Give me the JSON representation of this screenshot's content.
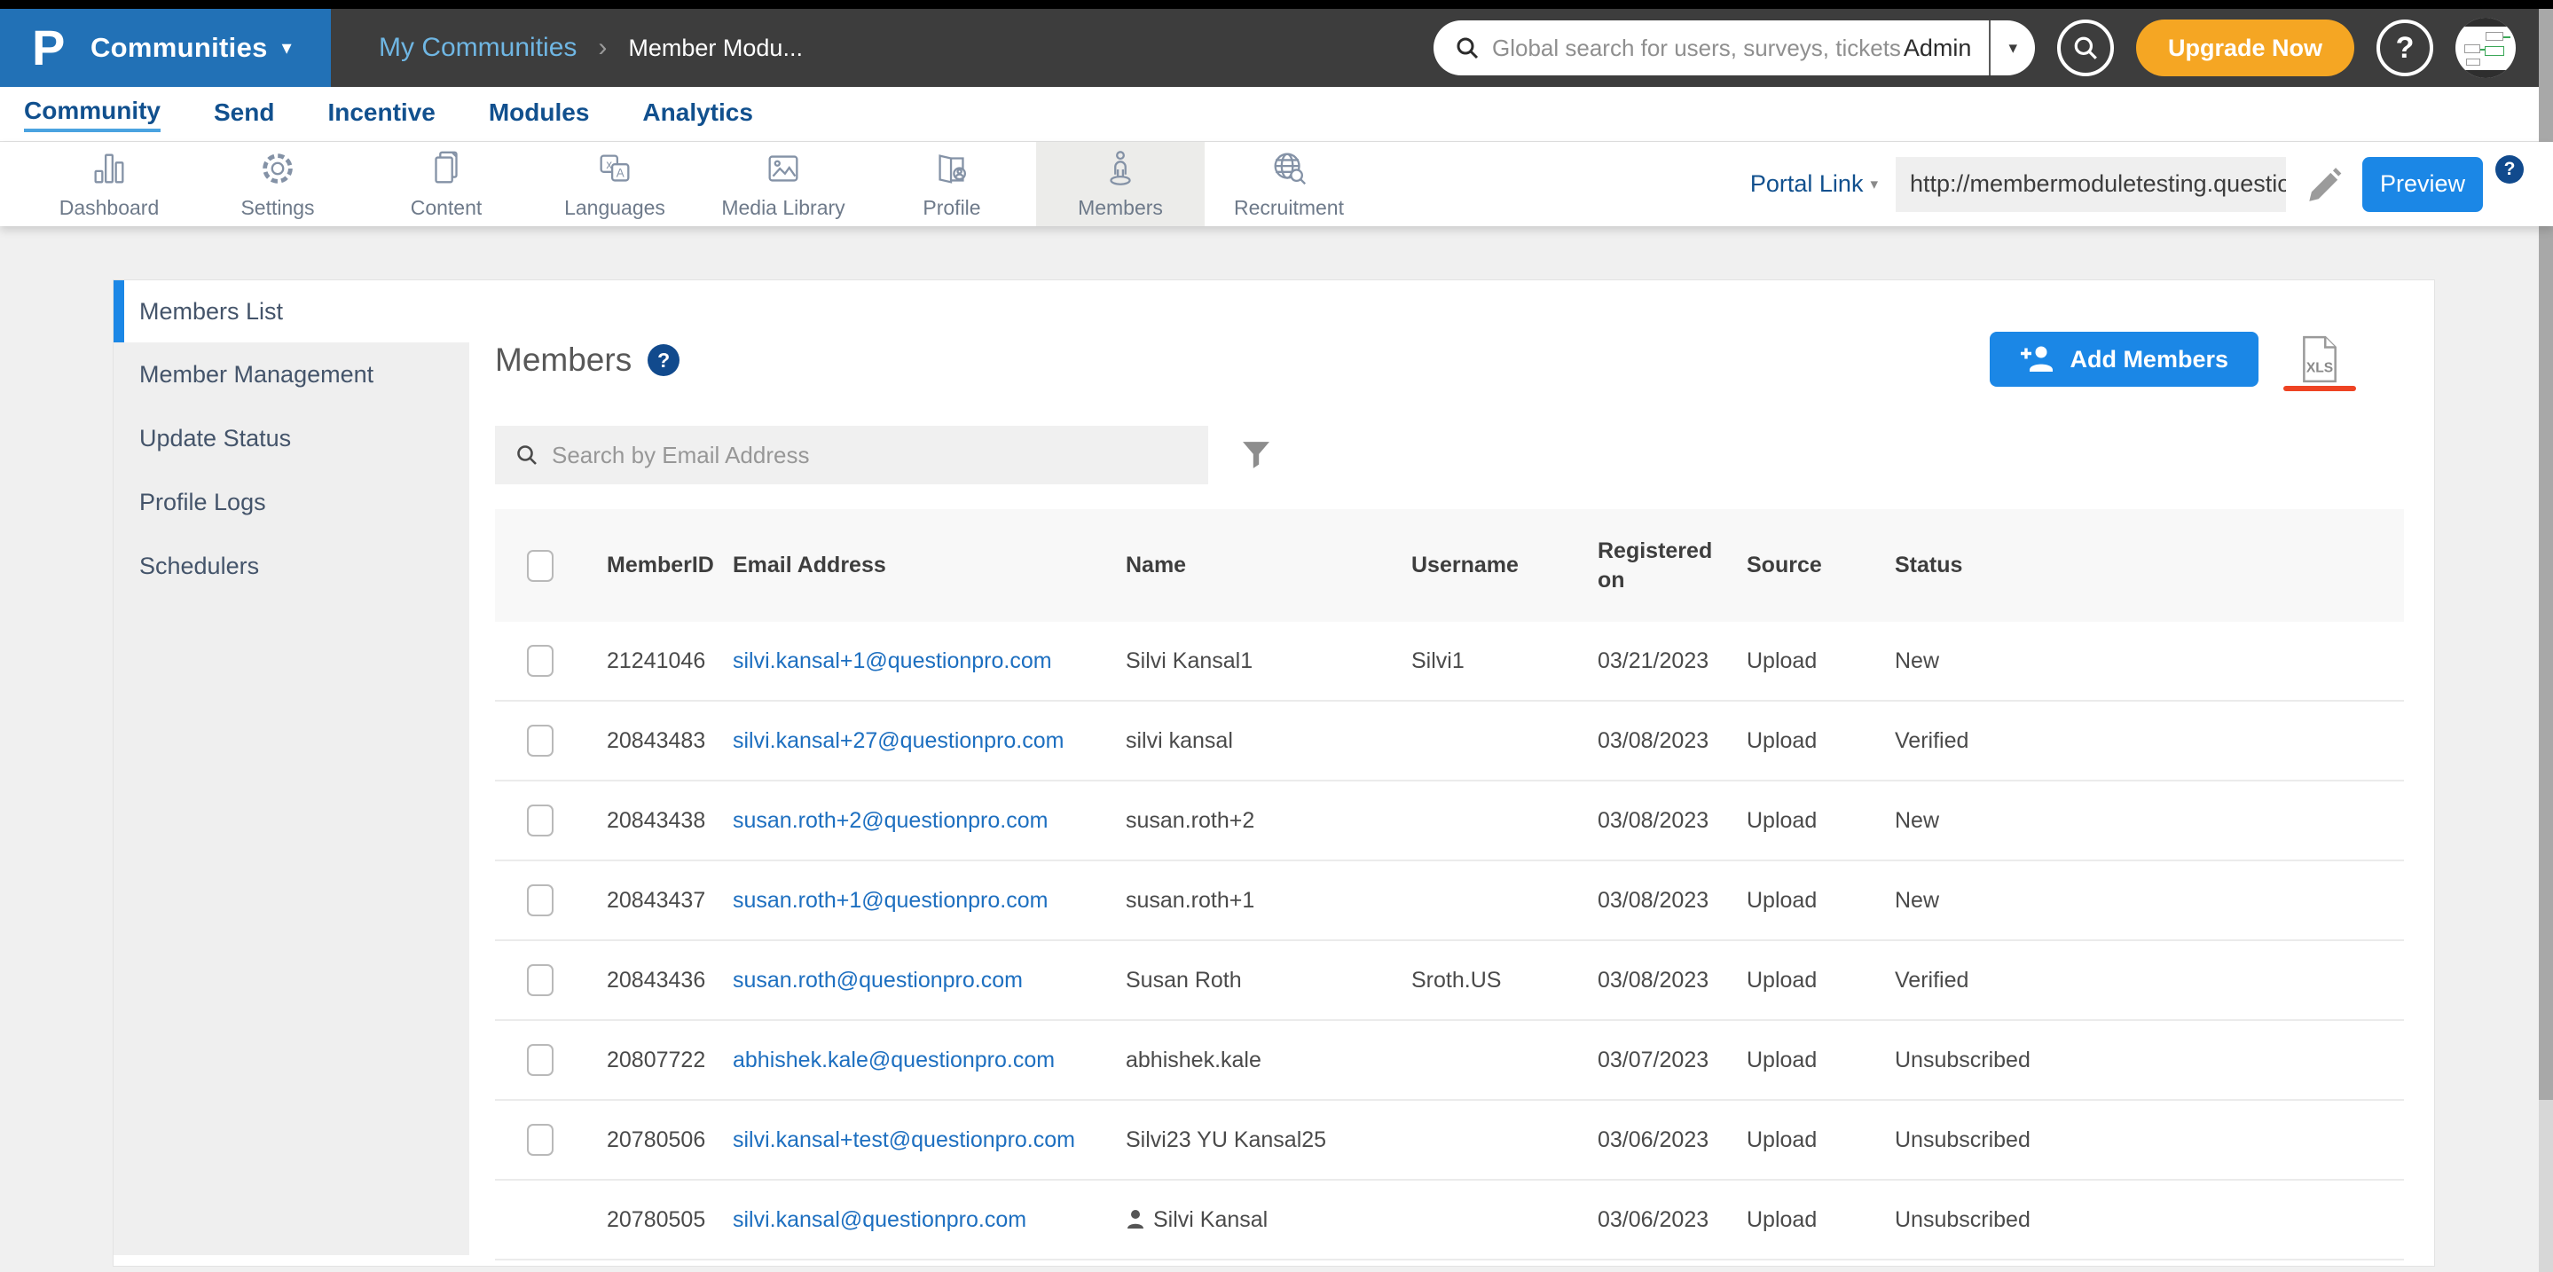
{
  "topbar": {
    "brand_label": "Communities",
    "breadcrumb": {
      "parent": "My Communities",
      "separator": "›",
      "current": "Member Modu..."
    },
    "global_search": {
      "placeholder": "Global search for users, surveys, tickets",
      "scope": "Admin"
    },
    "upgrade_label": "Upgrade Now",
    "help_label": "?"
  },
  "nav": {
    "items": [
      {
        "label": "Community",
        "active": true
      },
      {
        "label": "Send",
        "active": false
      },
      {
        "label": "Incentive",
        "active": false
      },
      {
        "label": "Modules",
        "active": false
      },
      {
        "label": "Analytics",
        "active": false
      }
    ]
  },
  "toolbar": {
    "tabs": [
      {
        "label": "Dashboard",
        "icon": "dashboard-icon",
        "active": false
      },
      {
        "label": "Settings",
        "icon": "settings-icon",
        "active": false
      },
      {
        "label": "Content",
        "icon": "content-icon",
        "active": false
      },
      {
        "label": "Languages",
        "icon": "languages-icon",
        "active": false
      },
      {
        "label": "Media Library",
        "icon": "media-library-icon",
        "active": false
      },
      {
        "label": "Profile",
        "icon": "profile-icon",
        "active": false
      },
      {
        "label": "Members",
        "icon": "members-icon",
        "active": true
      },
      {
        "label": "Recruitment",
        "icon": "recruitment-icon",
        "active": false
      }
    ],
    "portal_link_label": "Portal Link",
    "portal_url": "http://membermoduletesting.questio",
    "preview_label": "Preview",
    "preview_help": "?"
  },
  "sidebar": {
    "active_item": "Members List",
    "items": [
      "Member Management",
      "Update Status",
      "Profile Logs",
      "Schedulers"
    ]
  },
  "main": {
    "title": "Members",
    "title_help": "?",
    "add_members_label": "Add Members",
    "export_label": "XLS",
    "search_placeholder": "Search by Email Address"
  },
  "table": {
    "columns": [
      "MemberID",
      "Email Address",
      "Name",
      "Username",
      "Registered on",
      "Source",
      "Status"
    ],
    "rows": [
      {
        "member_id": "21241046",
        "email": "silvi.kansal+1@questionpro.com",
        "name": "Silvi Kansal1",
        "username": "Silvi1",
        "registered_on": "03/21/2023",
        "source": "Upload",
        "status": "New",
        "checkbox": true,
        "person_icon": false
      },
      {
        "member_id": "20843483",
        "email": "silvi.kansal+27@questionpro.com",
        "name": "silvi kansal",
        "username": "",
        "registered_on": "03/08/2023",
        "source": "Upload",
        "status": "Verified",
        "checkbox": true,
        "person_icon": false
      },
      {
        "member_id": "20843438",
        "email": "susan.roth+2@questionpro.com",
        "name": "susan.roth+2",
        "username": "",
        "registered_on": "03/08/2023",
        "source": "Upload",
        "status": "New",
        "checkbox": true,
        "person_icon": false
      },
      {
        "member_id": "20843437",
        "email": "susan.roth+1@questionpro.com",
        "name": "susan.roth+1",
        "username": "",
        "registered_on": "03/08/2023",
        "source": "Upload",
        "status": "New",
        "checkbox": true,
        "person_icon": false
      },
      {
        "member_id": "20843436",
        "email": "susan.roth@questionpro.com",
        "name": "Susan Roth",
        "username": "Sroth.US",
        "registered_on": "03/08/2023",
        "source": "Upload",
        "status": "Verified",
        "checkbox": true,
        "person_icon": false
      },
      {
        "member_id": "20807722",
        "email": "abhishek.kale@questionpro.com",
        "name": "abhishek.kale",
        "username": "",
        "registered_on": "03/07/2023",
        "source": "Upload",
        "status": "Unsubscribed",
        "checkbox": true,
        "person_icon": false
      },
      {
        "member_id": "20780506",
        "email": "silvi.kansal+test@questionpro.com",
        "name": "Silvi23 YU Kansal25",
        "username": "",
        "registered_on": "03/06/2023",
        "source": "Upload",
        "status": "Unsubscribed",
        "checkbox": true,
        "person_icon": false
      },
      {
        "member_id": "20780505",
        "email": "silvi.kansal@questionpro.com",
        "name": "Silvi Kansal",
        "username": "",
        "registered_on": "03/06/2023",
        "source": "Upload",
        "status": "Unsubscribed",
        "checkbox": false,
        "person_icon": true
      }
    ]
  },
  "colors": {
    "accent_blue": "#1b87e6",
    "brand_blue": "#2271b6",
    "header_dark": "#3d3d3d",
    "upgrade_orange": "#f5a623",
    "nav_blue": "#11508e",
    "link_blue": "#1d6fc0",
    "help_navy": "#114a8d",
    "export_underline_red": "#ee4323"
  }
}
